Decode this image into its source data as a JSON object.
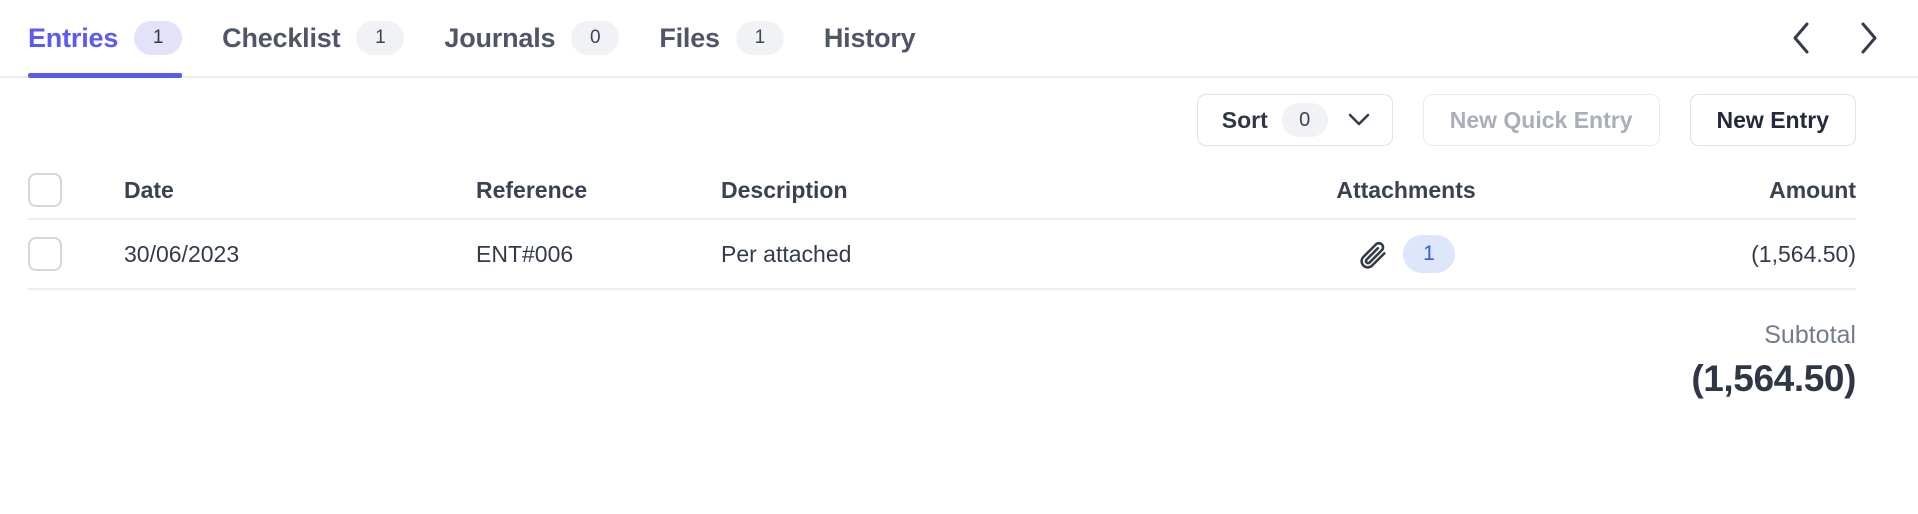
{
  "tabs": {
    "items": [
      {
        "label": "Entries",
        "badge": "1",
        "active": true
      },
      {
        "label": "Checklist",
        "badge": "1",
        "active": false
      },
      {
        "label": "Journals",
        "badge": "0",
        "active": false
      },
      {
        "label": "Files",
        "badge": "1",
        "active": false
      },
      {
        "label": "History",
        "badge": null,
        "active": false
      }
    ],
    "prev_icon": "chevron-left-icon",
    "next_icon": "chevron-right-icon"
  },
  "toolbar": {
    "sort_label": "Sort",
    "sort_count": "0",
    "sort_chevron_icon": "chevron-down-icon",
    "new_quick_entry_label": "New Quick Entry",
    "new_quick_entry_disabled": true,
    "new_entry_label": "New Entry"
  },
  "table": {
    "columns": [
      {
        "key": "select",
        "label": ""
      },
      {
        "key": "date",
        "label": "Date"
      },
      {
        "key": "reference",
        "label": "Reference"
      },
      {
        "key": "description",
        "label": "Description"
      },
      {
        "key": "attachments",
        "label": "Attachments"
      },
      {
        "key": "amount",
        "label": "Amount"
      }
    ],
    "rows": [
      {
        "date": "30/06/2023",
        "reference": "ENT#006",
        "description": "Per attached",
        "attachment_icon": "paperclip-icon",
        "attachment_count": "1",
        "amount": "(1,564.50)"
      }
    ]
  },
  "footer": {
    "subtotal_label": "Subtotal",
    "subtotal_value": "(1,564.50)"
  },
  "colors": {
    "accent": "#5b5bf0",
    "accent_badge_bg": "#e2e3fb",
    "neutral_badge_bg": "#f1f2f5",
    "attachment_badge_bg": "#dde6fb",
    "attachment_badge_text": "#2f5fe0",
    "text_primary": "#333b4a",
    "text_muted": "#737b8d",
    "border": "#eceef2"
  }
}
